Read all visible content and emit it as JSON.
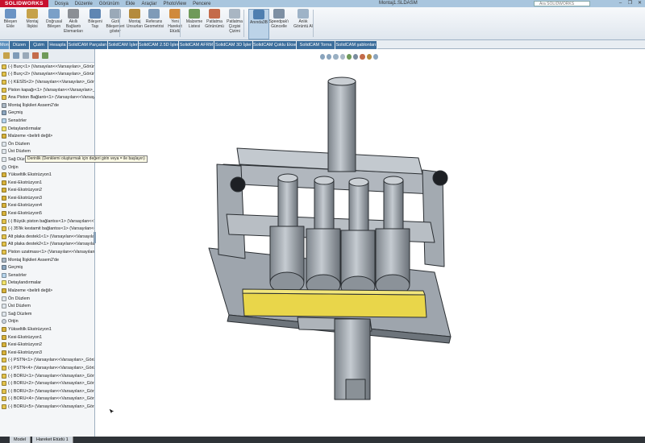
{
  "app": {
    "logo": "SOLIDWORKS",
    "menu": [
      "Dosya",
      "Düzenle",
      "Görünüm",
      "Ekle",
      "Araçlar",
      "PhotoView",
      "Pencere"
    ],
    "document_title": "Montaj1.SLDASM",
    "search_placeholder": "Ara SOLIDWORKS"
  },
  "ribbon": {
    "buttons": [
      {
        "label": "Bileşen Ekle",
        "icon": "insert-component-icon",
        "color": "#6a93c4"
      },
      {
        "label": "Montaj İlişkisi",
        "icon": "mate-icon",
        "color": "#c6a24a"
      },
      {
        "label": "Doğrusal Bileşen",
        "icon": "linear-pattern-icon",
        "color": "#7aa0c8"
      },
      {
        "label": "Akıllı Bağlantı Elemanları",
        "icon": "smart-fasteners-icon",
        "color": "#8b8f95"
      },
      {
        "label": "Bileşeni Taşı",
        "icon": "move-component-icon",
        "color": "#5f86b3"
      },
      {
        "label": "Gizli Bileşenleri göster",
        "icon": "show-hidden-icon",
        "color": "#9aa9b8"
      },
      {
        "label": "Montaj Unsurları",
        "icon": "assembly-features-icon",
        "color": "#b48b3d"
      },
      {
        "label": "Referans Geometrisi",
        "icon": "reference-geometry-icon",
        "color": "#7f9bb8"
      },
      {
        "label": "Yeni Hareket Etüdü",
        "icon": "motion-study-icon",
        "color": "#d08a3c"
      },
      {
        "label": "Malzeme Listesi",
        "icon": "bom-icon",
        "color": "#6f9a5a"
      },
      {
        "label": "Patlatma Görünümü",
        "icon": "exploded-view-icon",
        "color": "#c46b4a"
      },
      {
        "label": "Patlatma Çizgisi Çizimi",
        "icon": "explode-line-icon",
        "color": "#a9b6c3"
      },
      {
        "label": "Anında3B",
        "icon": "instant3d-icon",
        "color": "#4f7fb0"
      },
      {
        "label": "Speedpak'ı Güncelle",
        "icon": "speedpak-icon",
        "color": "#7d8fa3"
      },
      {
        "label": "Anlık Görüntü Al",
        "icon": "snapshot-icon",
        "color": "#9eb3c7"
      }
    ],
    "active_index": 12
  },
  "tabs": [
    "Montaj",
    "Düzen",
    "Çizim",
    "Hesapla",
    "SolidCAM Parçaları",
    "SolidCAM İşler",
    "SolidCAM 2.5D İşler",
    "SolidCAM AFRM",
    "SolidCAM 3D İşler",
    "SolidCAM Çoklu Eksen",
    "SolidCAM Torna",
    "SolidCAM şablonları"
  ],
  "tree": {
    "items": [
      {
        "text": "(-) Burç<1> (Varsayılan<<Varsayılan>_Görüntü",
        "icon": "asm"
      },
      {
        "text": "(-) Burç<2> (Varsayılan<<Varsayılan>_Görüntü",
        "icon": "asm"
      },
      {
        "text": "(-) KESİS<2> (Varsayılan<<Varsayılan>_Görüntü",
        "icon": "asm"
      },
      {
        "text": "Piston kapağı<1> (Varsayılan<<Varsayılan>_Gö",
        "icon": "asm"
      },
      {
        "text": "Ana Piston Bağlantı<1> (Varsayılan<<Varsayılan",
        "icon": "asm"
      },
      {
        "text": "Montaj İlişkileri Assem2'de",
        "icon": "mate"
      },
      {
        "text": "Geçmiş",
        "icon": "gear"
      },
      {
        "text": "Sensörler",
        "icon": "sensor"
      },
      {
        "text": "Detaylandırmalar",
        "icon": "note"
      },
      {
        "text": "Malzeme <belirli değil>",
        "icon": "part"
      },
      {
        "text": "Ön Düzlem",
        "icon": "plane"
      },
      {
        "text": "Üst Düzlem",
        "icon": "plane"
      },
      {
        "text": "Sağ Düzlem",
        "icon": "plane"
      },
      {
        "text": "Orijin",
        "icon": "origin"
      },
      {
        "text": "Yükseltilk Ekstrüzyon1",
        "icon": "part"
      },
      {
        "text": "Kesi-Ekstrüzyon1",
        "icon": "part"
      },
      {
        "text": "Kesi-Ekstrüzyon2",
        "icon": "part"
      },
      {
        "text": "Kesi-Ekstrüzyon3",
        "icon": "part"
      },
      {
        "text": "Kesi-Ekstrüzyon4",
        "icon": "part"
      },
      {
        "text": "Kesi-Ekstrüzyon5",
        "icon": "part"
      },
      {
        "text": "(-) Büyük piston bağlantısı<1> (Varsayılan<<Var",
        "icon": "asm"
      },
      {
        "text": "(-) 35'lik kestamit bağlantısı<1> (Varsayılan<<V",
        "icon": "asm"
      },
      {
        "text": "Alt plaka destek1<1> (Varsayılan<<Varsayılan>",
        "icon": "asm"
      },
      {
        "text": "Alt plaka destek2<1> (Varsayılan<<Varsayılan>",
        "icon": "asm"
      },
      {
        "text": "Piston uzatması<1> (Varsayılan<<Varsayılan>_G",
        "icon": "asm"
      },
      {
        "text": "Montaj İlişkileri Assem2'de",
        "icon": "mate"
      },
      {
        "text": "Geçmiş",
        "icon": "gear"
      },
      {
        "text": "Sensörler",
        "icon": "sensor"
      },
      {
        "text": "Detaylandırmalar",
        "icon": "note"
      },
      {
        "text": "Malzeme <belirli değil>",
        "icon": "part"
      },
      {
        "text": "Ön Düzlem",
        "icon": "plane"
      },
      {
        "text": "Üst Düzlem",
        "icon": "plane"
      },
      {
        "text": "Sağ Düzlem",
        "icon": "plane"
      },
      {
        "text": "Orijin",
        "icon": "origin"
      },
      {
        "text": "Yükseltilk Ekstrüzyon1",
        "icon": "part"
      },
      {
        "text": "Kesi-Ekstrüzyon1",
        "icon": "part"
      },
      {
        "text": "Kesi-Ekstrüzyon2",
        "icon": "part"
      },
      {
        "text": "Kesi-Ekstrüzyon3",
        "icon": "part"
      },
      {
        "text": "(-) PSTN<1> (Varsayılan<<Varsayılan>_Görüntü",
        "icon": "asm"
      },
      {
        "text": "(-) PSTN<4> (Varsayılan<<Varsayılan>_Görüntü",
        "icon": "asm"
      },
      {
        "text": "(-) BORU<1> (Varsayılan<<Varsayılan>_Görüntü",
        "icon": "asm"
      },
      {
        "text": "(-) BORU<2> (Varsayılan<<Varsayılan>_Görüntü",
        "icon": "asm"
      },
      {
        "text": "(-) BORU<3> (Varsayılan<<Varsayılan>_Görüntü",
        "icon": "asm"
      },
      {
        "text": "(-) BORU<4> (Varsayılan<<Varsayılan>_Görüntü",
        "icon": "asm"
      },
      {
        "text": "(-) BORU<5> (Varsayılan<<Varsayılan>_Görünt",
        "icon": "asm"
      }
    ]
  },
  "tooltip": "Derinlik (Denklemi oluşturmak için değeri girin veya = ile başlayın)",
  "bottom_tabs": [
    "Model",
    "Hareket Etüdü 1"
  ],
  "colors": {
    "part_gray": "#a9afb6",
    "part_dark": "#6d747b",
    "highlight_yellow": "#e9d64a",
    "tab_blue": "#3c6e9c"
  }
}
